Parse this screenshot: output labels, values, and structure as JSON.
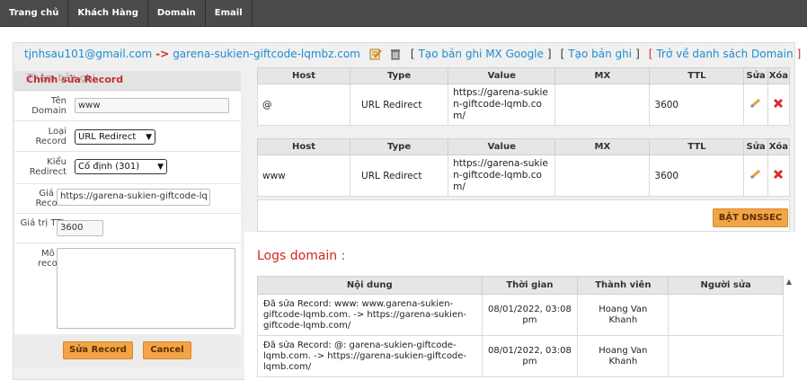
{
  "nav": {
    "items": [
      "Trang chủ",
      "Khách Hàng",
      "Domain",
      "Email"
    ]
  },
  "breadcrumb": {
    "email": "tjnhsau101@gmail.com",
    "arrow": "->",
    "domain": "garena-sukien-giftcode-lqmbz.com",
    "link_mx_google": "Tạo bản ghi MX Google",
    "link_create_record": "Tạo bản ghi",
    "link_back": "Trở về danh sách Domain",
    "bracket_open": "[",
    "bracket_close": "]"
  },
  "ghost_title": "Thêm bản ghi",
  "form": {
    "title": "Chỉnh sửa Record",
    "label_domain": "Tên Domain",
    "value_domain": "www",
    "label_type": "Loại Record",
    "value_type": "URL Redirect",
    "label_redirect": "Kiểu Redirect",
    "value_redirect": "Cố định (301)",
    "label_value": "Giá trị Record",
    "value_value": "https://garena-sukien-giftcode-lq",
    "label_ttl": "Giá trị TTL",
    "value_ttl": "3600",
    "label_desc": "Mô tả record",
    "value_desc": "",
    "save_button": "Sửa Record",
    "cancel_button": "Cancel"
  },
  "records": {
    "headers": [
      "Host",
      "Type",
      "Value",
      "MX",
      "TTL",
      "Sửa",
      "Xóa"
    ],
    "rows": [
      {
        "host": "@",
        "type": "URL Redirect",
        "value": "https://garena-sukien-giftcode-lqmb.com/",
        "mx": "",
        "ttl": "3600"
      },
      {
        "host": "www",
        "type": "URL Redirect",
        "value": "https://garena-sukien-giftcode-lqmb.com/",
        "mx": "",
        "ttl": "3600"
      }
    ]
  },
  "dnssec_button": "BẬT DNSSEC",
  "logs": {
    "title": "Logs domain :",
    "headers": [
      "Nội dung",
      "Thời gian",
      "Thành viên",
      "Người sửa"
    ],
    "rows": [
      {
        "content": "Đã sửa Record: www: www.garena-sukien-giftcode-lqmb.com. -> https://garena-sukien-giftcode-lqmb.com/",
        "time": "08/01/2022, 03:08 pm",
        "member": "Hoang Van Khanh",
        "editor": ""
      },
      {
        "content": "Đã sửa Record: @: garena-sukien-giftcode-lqmb.com. -> https://garena-sukien-giftcode-lqmb.com/",
        "time": "08/01/2022, 03:08 pm",
        "member": "Hoang Van Khanh",
        "editor": ""
      }
    ]
  },
  "colors": {
    "nav_bg": "#4a4a4a",
    "link_blue": "#1f8ccf",
    "accent_red": "#d4261e",
    "button_orange": "#f3a447"
  }
}
